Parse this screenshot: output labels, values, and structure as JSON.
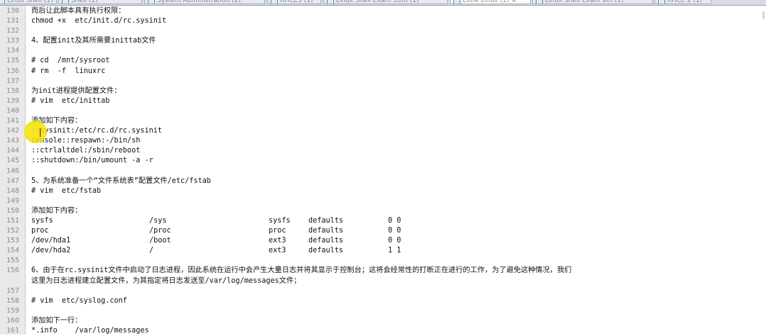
{
  "tabs": [
    {
      "label": "Linux Shell (1)",
      "active": false
    },
    {
      "label": "Shell (1)",
      "active": false
    },
    {
      "label": "System Administration (2)",
      "active": false
    },
    {
      "label": "RHCE5 (1)",
      "active": false
    },
    {
      "label": "Linux Shell Exam 10th (1)",
      "active": false
    },
    {
      "label": "Little Linux (1)",
      "active": true
    },
    {
      "label": "Linux Shell Exam 9th (1)",
      "active": false
    },
    {
      "label": "RHCE 2 (1)",
      "active": false
    }
  ],
  "lines": [
    {
      "n": "130",
      "text": "而后让此脚本具有执行权限："
    },
    {
      "n": "131",
      "text": "chmod +x  etc/init.d/rc.sysinit"
    },
    {
      "n": "132",
      "text": ""
    },
    {
      "n": "133",
      "text": "4、配置init及其所需要inittab文件"
    },
    {
      "n": "134",
      "text": ""
    },
    {
      "n": "135",
      "text": "# cd  /mnt/sysroot"
    },
    {
      "n": "136",
      "text": "# rm  -f  linuxrc"
    },
    {
      "n": "137",
      "text": ""
    },
    {
      "n": "138",
      "text": "为init进程提供配置文件："
    },
    {
      "n": "139",
      "text": "# vim  etc/inittab"
    },
    {
      "n": "140",
      "text": ""
    },
    {
      "n": "141",
      "text": "添加如下内容："
    },
    {
      "n": "142",
      "text": "::sysinit:/etc/rc.d/rc.sysinit"
    },
    {
      "n": "143",
      "text": "console::respawn:-/bin/sh"
    },
    {
      "n": "144",
      "text": "::ctrlaltdel:/sbin/reboot"
    },
    {
      "n": "145",
      "text": "::shutdown:/bin/umount -a -r"
    },
    {
      "n": "146",
      "text": ""
    },
    {
      "n": "147",
      "text": "5、为系统准备一个“文件系统表”配置文件/etc/fstab"
    },
    {
      "n": "148",
      "text": "# vim  etc/fstab"
    },
    {
      "n": "149",
      "text": ""
    },
    {
      "n": "150",
      "text": "添加如下内容："
    },
    {
      "n": "151",
      "cols": [
        "sysfs",
        "/sys",
        "sysfs",
        "defaults",
        "0 0"
      ]
    },
    {
      "n": "152",
      "cols": [
        "proc",
        "/proc",
        "proc",
        "defaults",
        "0 0"
      ]
    },
    {
      "n": "153",
      "cols": [
        "/dev/hda1",
        "/boot",
        "ext3",
        "defaults",
        "0 0"
      ]
    },
    {
      "n": "154",
      "cols": [
        "/dev/hda2",
        "/",
        "ext3",
        "defaults",
        "1 1"
      ]
    },
    {
      "n": "155",
      "text": ""
    },
    {
      "n": "156",
      "text": "6、由于在rc.sysinit文件中启动了日志进程，因此系统在运行中会产生大量日志并将其显示于控制台；这将会经常性的打断正在进行的工作，为了避免这种情况，我们"
    },
    {
      "n": "",
      "text": "这里为日志进程建立配置文件，为其指定将日志发送至/var/log/messages文件；"
    },
    {
      "n": "157",
      "text": ""
    },
    {
      "n": "158",
      "text": "# vim  etc/syslog.conf"
    },
    {
      "n": "159",
      "text": ""
    },
    {
      "n": "160",
      "text": "添加如下一行："
    },
    {
      "n": "161",
      "text": "*.info    /var/log/messages"
    }
  ]
}
